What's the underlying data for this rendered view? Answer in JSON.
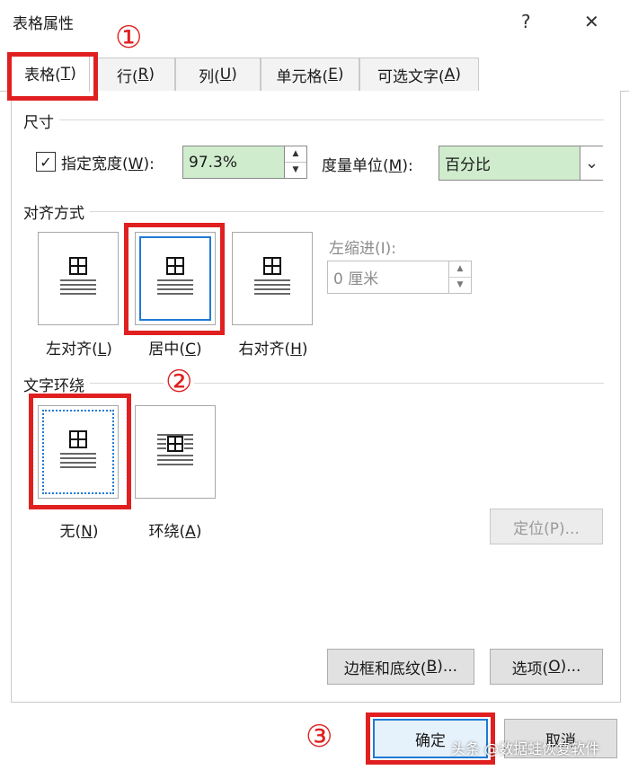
{
  "window": {
    "title": "表格属性",
    "help_label": "?",
    "close_label": "✕"
  },
  "tabs": [
    {
      "label": "表格(",
      "key": "T",
      "tail": ")"
    },
    {
      "label": "行(",
      "key": "R",
      "tail": ")"
    },
    {
      "label": "列(",
      "key": "U",
      "tail": ")"
    },
    {
      "label": "单元格(",
      "key": "E",
      "tail": ")"
    },
    {
      "label": "可选文字(",
      "key": "A",
      "tail": ")"
    }
  ],
  "size_section": {
    "title": "尺寸",
    "preferred_width_checkbox": {
      "checked_glyph": "✓",
      "label": "指定宽度(",
      "key": "W",
      "tail": "):"
    },
    "width_value": "97.3%",
    "measure_in_label": {
      "label": "度量单位(",
      "key": "M",
      "tail": "):"
    },
    "measure_in_value": "百分比"
  },
  "alignment_section": {
    "title": "对齐方式",
    "options": [
      {
        "label": "左对齐(",
        "key": "L",
        "tail": ")"
      },
      {
        "label": "居中(",
        "key": "C",
        "tail": ")"
      },
      {
        "label": "右对齐(",
        "key": "H",
        "tail": ")"
      }
    ],
    "indent_label": "左缩进(I):",
    "indent_value": "0 厘米"
  },
  "wrap_section": {
    "title": "文字环绕",
    "options": [
      {
        "label": "无(",
        "key": "N",
        "tail": ")"
      },
      {
        "label": "环绕(",
        "key": "A",
        "tail": ")"
      }
    ],
    "positioning_button": "定位(P)..."
  },
  "buttons": {
    "borders": {
      "label": "边框和底纹(",
      "key": "B",
      "tail": ")..."
    },
    "options": {
      "label": "选项(",
      "key": "O",
      "tail": ")..."
    },
    "ok": "确定",
    "cancel": "取消"
  },
  "annotations": {
    "step1": "①",
    "step2": "②",
    "step3": "③"
  },
  "watermark": "头条 @数据蛙恢复软件",
  "colors": {
    "highlight_red": "#e02020",
    "selection_blue": "#1e7ad6",
    "input_green": "#cfeccd"
  },
  "icons": {
    "arrow_up": "▲",
    "arrow_down": "▼",
    "dropdown": "⌄"
  }
}
